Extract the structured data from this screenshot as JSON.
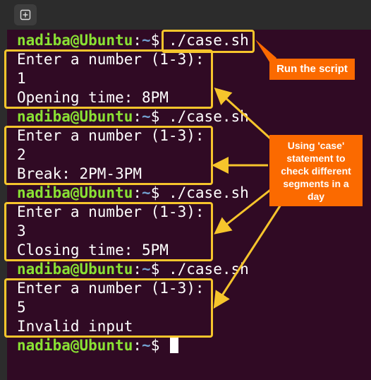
{
  "terminal": {
    "prompt_user": "nadiba@Ubuntu",
    "prompt_sep": ":",
    "prompt_path": "~",
    "prompt_dollar": "$ ",
    "command": "./case.sh",
    "runs": [
      {
        "question": "Enter a number (1-3):",
        "input": "1",
        "output": "Opening time: 8PM"
      },
      {
        "question": "Enter a number (1-3):",
        "input": "2",
        "output": "Break: 2PM-3PM"
      },
      {
        "question": "Enter a number (1-3):",
        "input": "3",
        "output": "Closing time: 5PM"
      },
      {
        "question": "Enter a number (1-3):",
        "input": "5",
        "output": "Invalid input"
      }
    ]
  },
  "annotations": {
    "run_script": "Run the script",
    "case_note": "Using 'case' statement to check different segments in a day"
  },
  "colors": {
    "background": "#300a24",
    "prompt_user": "#8ae234",
    "prompt_path": "#729fcf",
    "highlight": "#f6c52c",
    "callout": "#fb6a00"
  },
  "icons": {
    "new_tab": "new-tab-icon"
  }
}
